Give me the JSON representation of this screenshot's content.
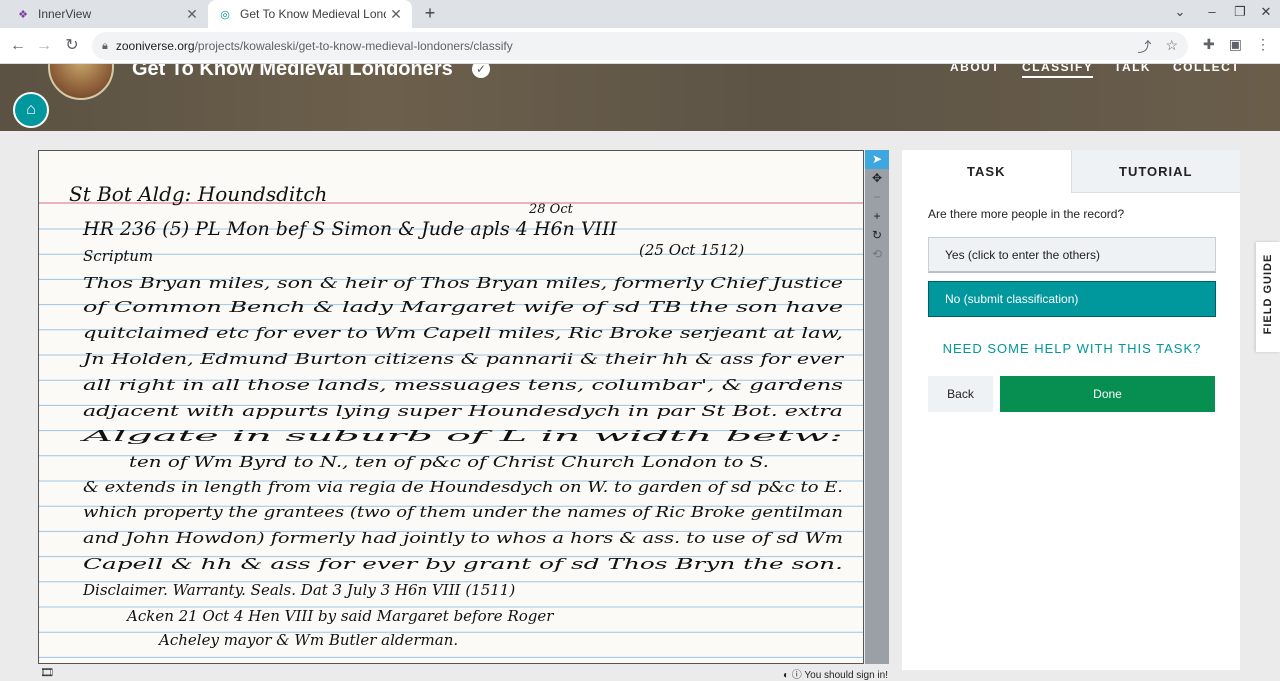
{
  "browser": {
    "tabs": [
      {
        "title": "InnerView",
        "icon": "innerview-icon"
      },
      {
        "title": "Get To Know Medieval Londoners",
        "icon": "zooniverse-icon"
      }
    ],
    "url_host": "zooniverse.org",
    "url_path": "/projects/kowaleski/get-to-know-medieval-londoners/classify"
  },
  "project": {
    "title": "Get To Know Medieval Londoners",
    "nav": [
      "ABOUT",
      "CLASSIFY",
      "TALK",
      "COLLECT"
    ],
    "active_nav": "CLASSIFY"
  },
  "subject": {
    "lines": [
      "St Bot Aldg: Houndsditch",
      "HR 236 (5)      PL   Mon   bef   S Simon & Jude apls 4 H6n VIII",
      "28 Oct",
      "(25 Oct 1512)",
      "Scriptum",
      "Thos Bryan miles, son & heir of Thos Bryan miles, formerly Chief Justice",
      "of Common Bench & lady Margaret wife of sd TB the son have",
      "quitclaimed etc for ever to Wm Capell miles, Ric Broke serjeant at law,",
      "Jn Holden, Edmund Burton citizens & pannarii & their hh & ass for ever",
      "all right in all those lands, messuages tens, columbar', & gardens",
      "adjacent with appurts lying super Houndesdych in par St Bot. extra",
      "Algate in suburb of L in width betw:",
      "ten of Wm Byrd to N., ten of p&c of Christ Church London to S.",
      "& extends in length from via regia de Houndesdych on W. to garden of sd p&c to E.",
      "which property the grantees (two of them under the names of Ric Broke gentilman",
      "and John Howdon) formerly had jointly to whos a hors & ass. to use of sd Wm",
      "Capell & hh & ass for ever by grant of sd Thos Bryn the son.",
      "Disclaimer. Warranty. Seals. Dat 3 July 3 H6n VIII (1511)",
      "Acken 21 Oct 4 Hen VIII by said Margaret before Roger",
      "Acheley mayor & Wm Butler alderman."
    ]
  },
  "footer": {
    "signin": "You should sign in!"
  },
  "task": {
    "tab_task": "TASK",
    "tab_tutorial": "TUTORIAL",
    "question": "Are there more people in the record?",
    "answer_yes": "Yes (click to enter the others)",
    "answer_no": "No (submit classification)",
    "help": "NEED SOME HELP WITH THIS TASK?",
    "back": "Back",
    "done": "Done"
  },
  "field_guide": "FIELD GUIDE"
}
